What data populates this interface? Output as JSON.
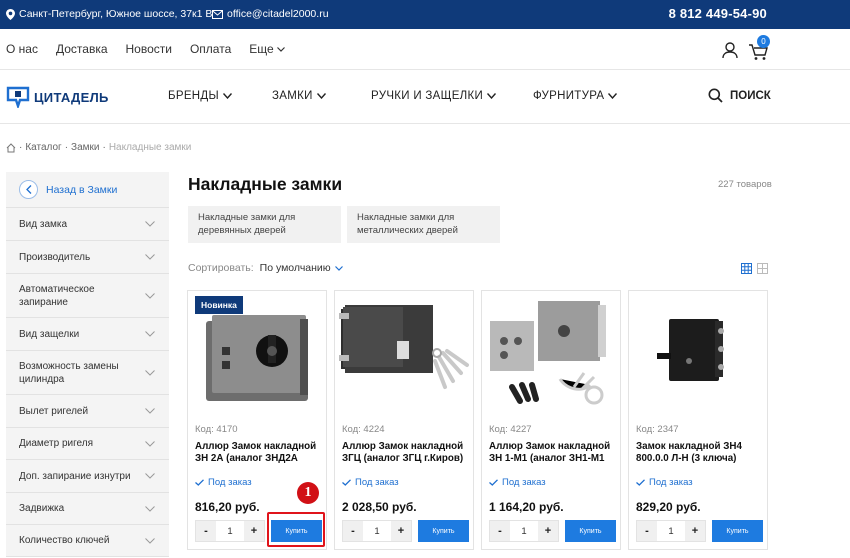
{
  "topbar": {
    "address": "Санкт-Петербург, Южное шоссе, 37к1 В",
    "email": "office@citadel2000.ru",
    "phone": "8 812 449-54-90"
  },
  "nav_secondary": {
    "links": [
      "О нас",
      "Доставка",
      "Новости",
      "Оплата",
      "Еще"
    ],
    "cart_count": "0"
  },
  "brand": {
    "name": "ЦИТАДЕЛЬ"
  },
  "nav_main": {
    "items": [
      "БРЕНДЫ",
      "ЗАМКИ",
      "РУЧКИ И ЗАЩЕЛКИ",
      "ФУРНИТУРА"
    ],
    "search_label": "ПОИСК"
  },
  "breadcrumb": {
    "items": [
      "Каталог",
      "Замки"
    ],
    "current": "Накладные замки"
  },
  "sidebar": {
    "back_label": "Назад в Замки",
    "filters": [
      "Вид замка",
      "Производитель",
      "Автоматическое запирание",
      "Вид защелки",
      "Возможность замены цилиндра",
      "Вылет ригелей",
      "Диаметр ригеля",
      "Доп. запирание изнутри",
      "Задвижка",
      "Количество ключей"
    ]
  },
  "catalog": {
    "title": "Накладные замки",
    "count": "227 товаров",
    "subcategories": [
      "Накладные замки для деревянных дверей",
      "Накладные замки для металлических дверей"
    ],
    "sort_label": "Сортировать:",
    "sort_value": "По умолчанию"
  },
  "products": [
    {
      "badge": "Новинка",
      "code": "Код: 4170",
      "name": "Аллюр Замок накладной ЗН 2А (аналог ЗНД2А",
      "availability": "Под заказ",
      "price": "816,20 руб.",
      "qty": "1",
      "buy": "Купить"
    },
    {
      "badge": "",
      "code": "Код: 4224",
      "name": "Аллюр Замок накладной ЗГЦ (аналог ЗГЦ г.Киров)",
      "availability": "Под заказ",
      "price": "2 028,50 руб.",
      "qty": "1",
      "buy": "Купить"
    },
    {
      "badge": "",
      "code": "Код: 4227",
      "name": "Аллюр Замок накладной ЗН 1-М1 (аналог ЗН1-М1",
      "availability": "Под заказ",
      "price": "1 164,20 руб.",
      "qty": "1",
      "buy": "Купить"
    },
    {
      "badge": "",
      "code": "Код: 2347",
      "name": "Замок накладной ЗН4 800.0.0 Л-Н (3 ключа)",
      "availability": "Под заказ",
      "price": "829,20 руб.",
      "qty": "1",
      "buy": "Купить"
    }
  ],
  "annotation": {
    "number": "1"
  },
  "colors": {
    "brand_dark": "#0f3a7a",
    "accent": "#1e7be0",
    "annotation": "#e0141b"
  }
}
